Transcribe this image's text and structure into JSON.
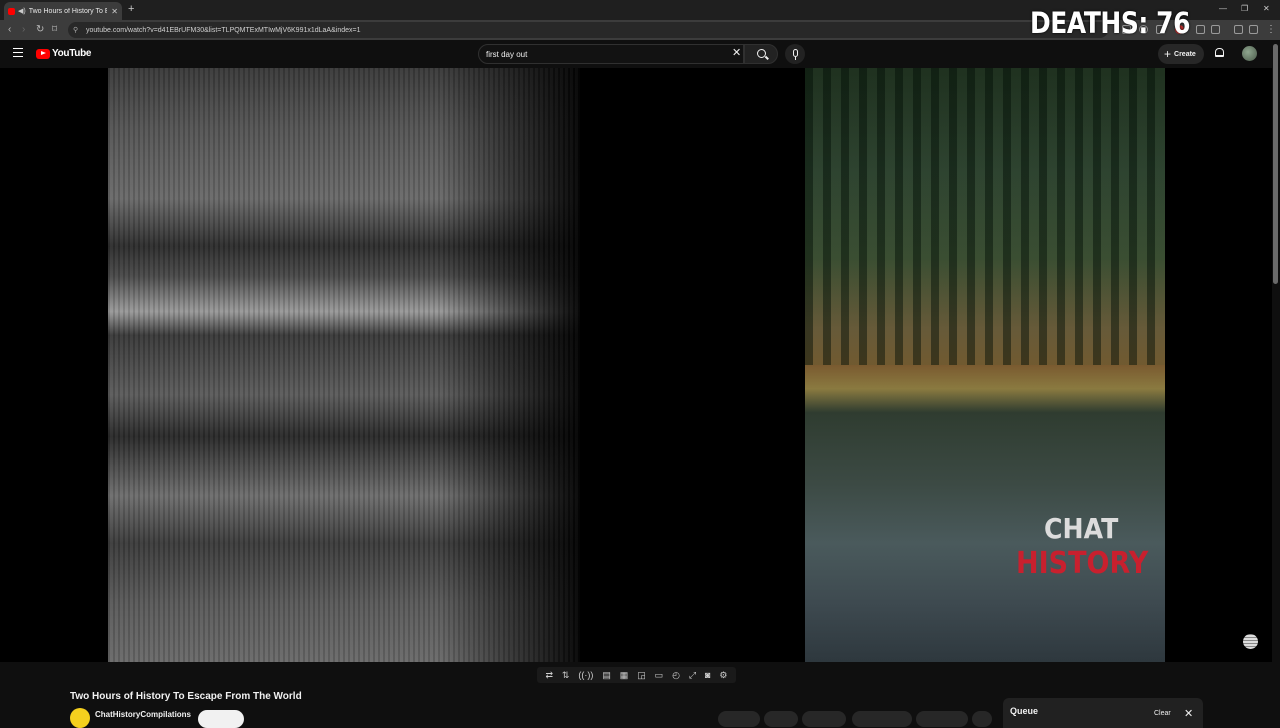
{
  "browser": {
    "tab_title": "Two Hours of History To Escape From The World",
    "url": "youtube.com/watch?v=d41EBrUFM30&list=TLPQMTExMTIwMjV6K991x1dLaA&index=1"
  },
  "masthead": {
    "logo_text": "YouTube",
    "search_value": "first day out",
    "create_label": "Create"
  },
  "video": {
    "overlay_text": "DEATHS: 76",
    "watermark_line1": "CHAT",
    "watermark_line2": "HISTORY",
    "title": "Two Hours of History To Escape From The World",
    "channel": "ChatHistoryCompilations"
  },
  "queue": {
    "title": "Queue",
    "clear_label": "Clear"
  },
  "colors": {
    "brand_red": "#ff0000",
    "watermark_red": "#c8202e",
    "background": "#0f0f0f"
  }
}
